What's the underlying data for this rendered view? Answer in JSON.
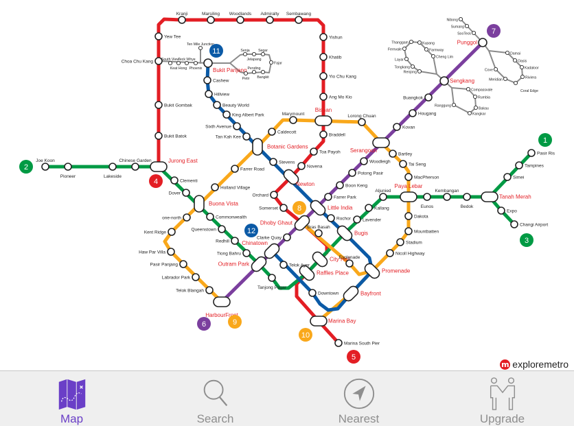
{
  "map": {
    "lines": [
      {
        "number": "4",
        "color": "#e31e24",
        "stations": [
          "Jurong East",
          "Bukit Batok",
          "Bukit Gombak",
          "Choa Chu Kang",
          "Yew Tee",
          "Kranji",
          "Marsiling",
          "Woodlands",
          "Admiralty",
          "Sembawang",
          "Yishun",
          "Khatib",
          "Yio Chu Kang",
          "Ang Mo Kio",
          "Bishan",
          "Braddell",
          "Toa Payoh",
          "Novena",
          "Newton",
          "Orchard",
          "Somerset",
          "Dhoby Ghaut",
          "City Hall",
          "Raffles Place",
          "Marina Bay",
          "Marina South Pier"
        ]
      },
      {
        "number": "2",
        "color": "#009a44",
        "stations": [
          "Joe Koon",
          "Pioneer",
          "Lakeside",
          "Chinese Garden",
          "Jurong East",
          "Clementi",
          "Dover",
          "Buona Vista",
          "Commonwealth",
          "Queenstown",
          "Redhill",
          "Tiong Bahru",
          "Outram Park",
          "Tanjong Pagar",
          "Raffles Place",
          "City Hall",
          "Bugis",
          "Lavender",
          "Kallang",
          "Aljunied",
          "Paya Lebar",
          "Eunos",
          "Kembangan",
          "Bedok",
          "Tanah Merah",
          "Simei",
          "Tampines",
          "Pasir Ris"
        ],
        "branch": [
          "Tanah Merah",
          "Expo",
          "Changi Airport"
        ]
      },
      {
        "number": "10",
        "color": "#f9a81b",
        "stations": [
          "HarbourFront",
          "Telok Blangah",
          "Labrador Park",
          "Pasir Panjang",
          "Haw Par Villa",
          "Kent Ridge",
          "one-north",
          "Buona Vista",
          "Holland Village",
          "Farrer Road",
          "Botanic Gardens",
          "Caldecott",
          "Marymount",
          "Bishan",
          "Lorong Chuan",
          "Serangoon",
          "Bartley",
          "Tai Seng",
          "MacPherson",
          "Paya Lebar",
          "Dakota",
          "Mountbatten",
          "Stadium",
          "Nicoll Highway",
          "Promenade",
          "Bayfront",
          "Marina Bay"
        ],
        "branch": [
          "Dhoby Ghaut",
          "Bras Basah",
          "Esplanade",
          "Promenade"
        ]
      },
      {
        "number": "6",
        "color": "#7b3f9e",
        "stations": [
          "HarbourFront",
          "Outram Park",
          "Chinatown",
          "Clarke Quay",
          "Dhoby Ghaut",
          "Little India",
          "Farrer Park",
          "Boon Keng",
          "Potong Pasir",
          "Woodleigh",
          "Serangoon",
          "Kovan",
          "Hougang",
          "Buangkok",
          "Sengkang",
          "Punggol"
        ]
      },
      {
        "number": "12",
        "color": "#0b5aa6",
        "stations": [
          "Bukit Panjang",
          "Cashew",
          "Hillview",
          "Beauty World",
          "King Albert Park",
          "Sixth Avenue",
          "Tan Kah Kee",
          "Botanic Gardens",
          "Stevens",
          "Newton",
          "Little India",
          "Rochor",
          "Bugis",
          "Promenade",
          "Bayfront",
          "Downtown",
          "Telok Ayer",
          "Chinatown"
        ]
      },
      {
        "number": "11",
        "color": "#888888",
        "stations": [
          "Choa Chu Kang",
          "South View",
          "Keat Hong",
          "Teck Whye",
          "Phoenix",
          "Bukit Panjang",
          "Ten Mile Junction",
          "Senja",
          "Jelapang",
          "Segar",
          "Fajar",
          "Bangkit",
          "Pending",
          "Petir"
        ]
      },
      {
        "number": "",
        "color": "#888888",
        "stations": [
          "Punggol",
          "Nibong",
          "Sumang",
          "SooTeck",
          "Damai",
          "Oasis",
          "Kadaloor",
          "Riviera",
          "Coral Edge",
          "Meridian",
          "Cove",
          "Sengkang",
          "Thanggam",
          "Kupang",
          "Farmway",
          "Cheng Lim",
          "Fernvale",
          "Layar",
          "Tongkang",
          "Renjong",
          "Compassvale",
          "Rumbia",
          "Bakau",
          "Kangkar",
          "Ranggung"
        ]
      }
    ],
    "badges": [
      {
        "label": "11",
        "color": "#0b5aa6"
      },
      {
        "label": "2",
        "color": "#009a44"
      },
      {
        "label": "4",
        "color": "#e31e24"
      },
      {
        "label": "1",
        "color": "#009a44"
      },
      {
        "label": "3",
        "color": "#009a44"
      },
      {
        "label": "7",
        "color": "#7b3f9e"
      },
      {
        "label": "8",
        "color": "#f9a81b"
      },
      {
        "label": "12",
        "color": "#0b5aa6"
      },
      {
        "label": "6",
        "color": "#7b3f9e"
      },
      {
        "label": "9",
        "color": "#f9a81b"
      },
      {
        "label": "10",
        "color": "#f9a81b"
      },
      {
        "label": "5",
        "color": "#e31e24"
      }
    ]
  },
  "logo": {
    "mark": "m",
    "text": "exploremetro"
  },
  "tabbar": {
    "active_color": "#6a3fc7",
    "tabs": [
      {
        "label": "Map",
        "icon": "map-icon",
        "active": true
      },
      {
        "label": "Search",
        "icon": "search-icon",
        "active": false
      },
      {
        "label": "Nearest",
        "icon": "location-arrow-icon",
        "active": false
      },
      {
        "label": "Upgrade",
        "icon": "handshake-icon",
        "active": false
      }
    ]
  }
}
